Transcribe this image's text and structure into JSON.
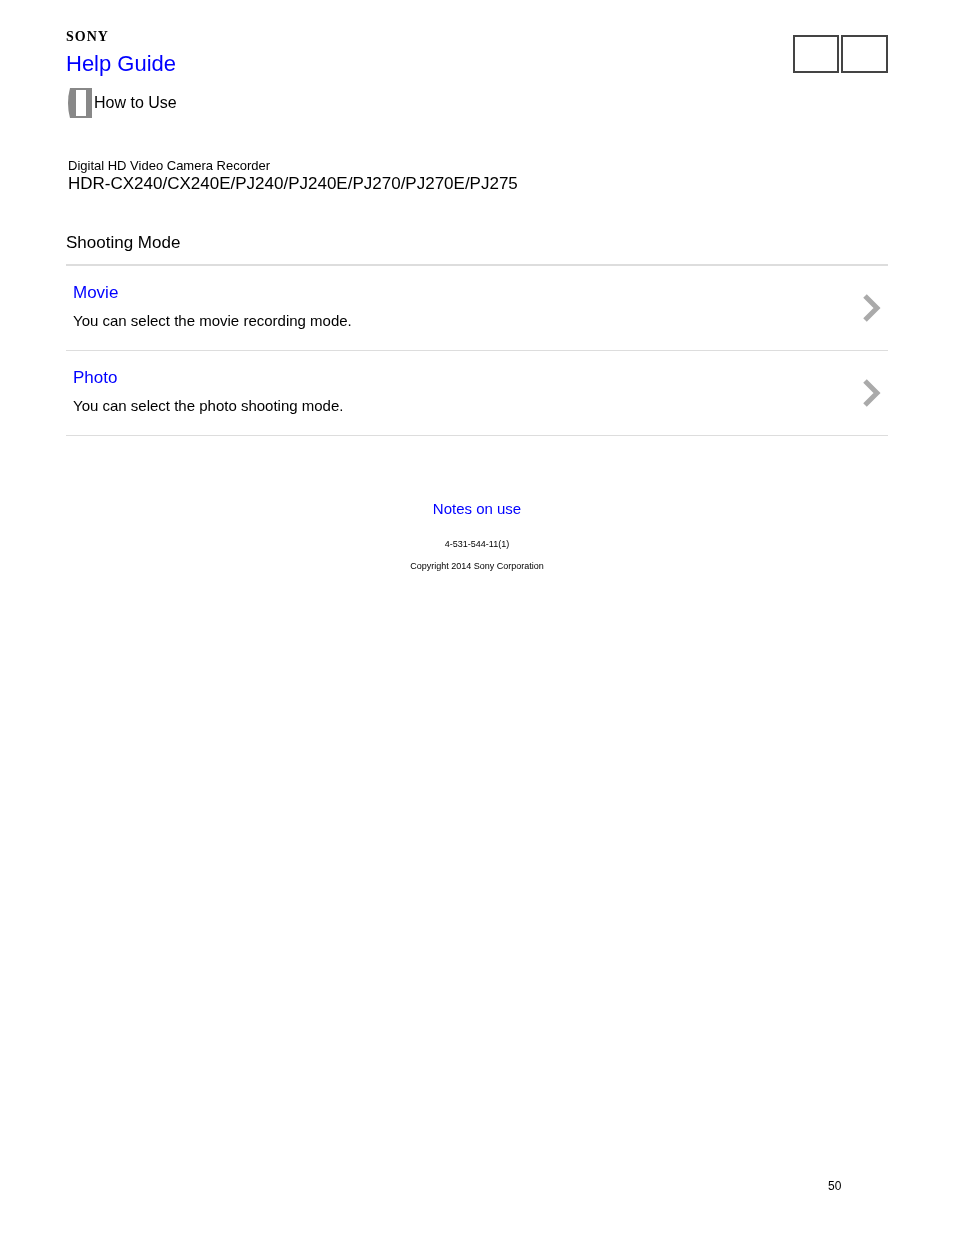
{
  "header": {
    "brand": "SONY",
    "title": "Help Guide",
    "section": "How to Use"
  },
  "product": {
    "category": "Digital HD Video Camera Recorder",
    "models": "HDR-CX240/CX240E/PJ240/PJ240E/PJ270/PJ270E/PJ275"
  },
  "page_title": "Shooting Mode",
  "items": [
    {
      "title": "Movie",
      "description": "You can select the movie recording mode."
    },
    {
      "title": "Photo",
      "description": "You can select the photo shooting mode."
    }
  ],
  "footer": {
    "link": "Notes on use",
    "code": "4-531-544-11(1)",
    "copyright": "Copyright 2014 Sony Corporation"
  },
  "page_number": "50"
}
